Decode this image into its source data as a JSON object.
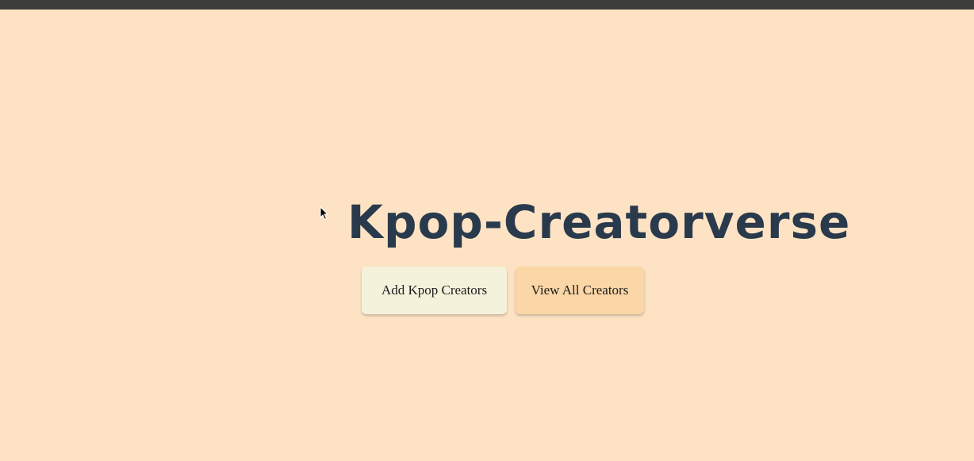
{
  "app": {
    "title": "Kpop-Creatorverse"
  },
  "actions": {
    "add_label": "Add Kpop Creators",
    "view_label": "View All Creators"
  },
  "colors": {
    "background": "#fde3c3",
    "title": "#2a3a4d",
    "add_button": "#f5f2dc",
    "view_button": "#fbd6a6",
    "top_bar": "#3d3d3b"
  },
  "icons": {
    "cursor": "mouse-pointer-icon"
  }
}
